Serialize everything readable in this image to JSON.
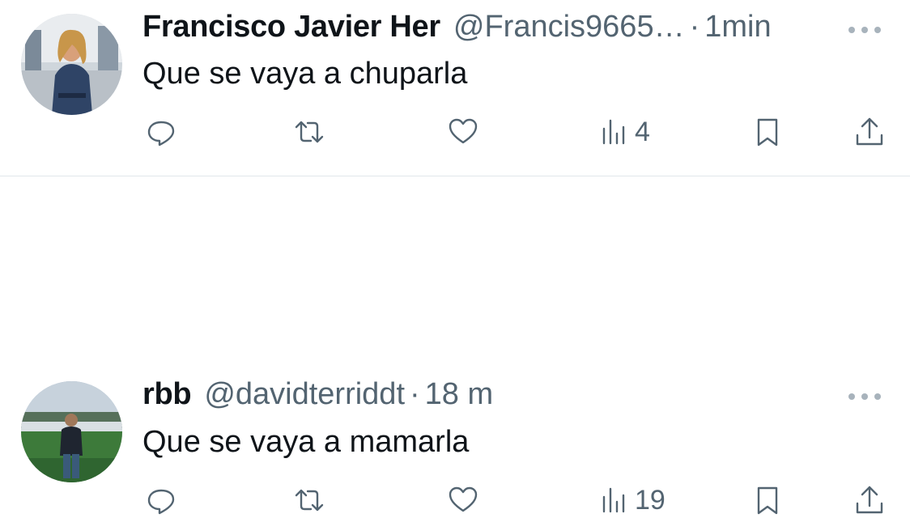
{
  "tweets": [
    {
      "name": "Francisco Javier Her",
      "handle": "@Francis9665…",
      "separator": "·",
      "time": "1min",
      "text": "Que se vaya a chuparla",
      "views": "4",
      "avatar_icon": "user-avatar-woman"
    },
    {
      "name": "rbb",
      "handle": "@davidterriddt",
      "separator": "·",
      "time": "18 m",
      "text": "Que se vaya a mamarla",
      "views": "19",
      "avatar_icon": "user-avatar-stadium"
    }
  ],
  "icons": {
    "reply": "reply-icon",
    "retweet": "retweet-icon",
    "like": "like-icon",
    "views": "views-icon",
    "bookmark": "bookmark-icon",
    "share": "share-icon",
    "more": "more-icon"
  },
  "colors": {
    "text": "#0f1419",
    "secondary": "#536471",
    "divider": "#e1e6ea"
  }
}
